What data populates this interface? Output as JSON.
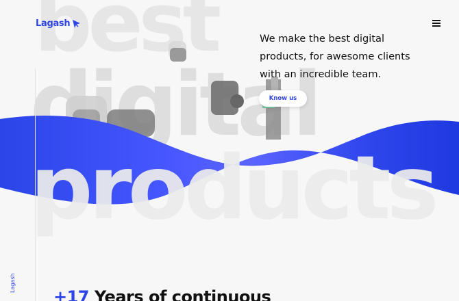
{
  "header": {
    "logo_text": "Lagash",
    "menu_icon": "hamburger-icon"
  },
  "hero": {
    "background_words": [
      "best",
      "digital",
      "products"
    ],
    "tagline": "We make the best digital products, for awesome clients with an incredible team.",
    "cta_label": "Know us"
  },
  "side": {
    "label": "Lagash"
  },
  "stats": {
    "count": "+17",
    "text": "Years of continuous"
  },
  "colors": {
    "brand_blue": "#2f46e6",
    "wave_blue_light": "#5a63ff",
    "wave_blue_dark": "#1f39e0",
    "background": "#f7f7f7",
    "text": "#111111"
  }
}
